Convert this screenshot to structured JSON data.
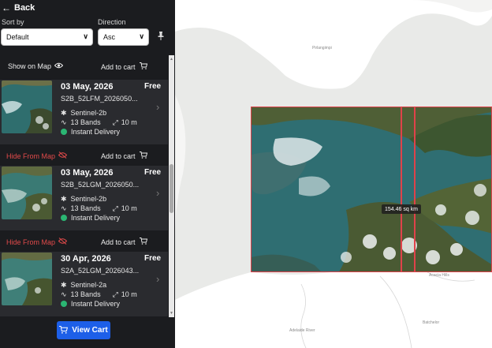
{
  "back_label": "Back",
  "sort": {
    "label": "Sort by",
    "value": "Default"
  },
  "direction": {
    "label": "Direction",
    "value": "Asc"
  },
  "top_actions": {
    "show_label": "Show on Map",
    "cart_label": "Add to cart"
  },
  "cards": [
    {
      "date": "03 May, 2026",
      "price": "Free",
      "product_id": "S2B_52LFM_2026050...",
      "satellite": "Sentinel-2b",
      "bands": "13 Bands",
      "resolution": "10 m",
      "delivery": "Instant Delivery",
      "hide_label": "Hide From Map",
      "cart_label": "Add to cart"
    },
    {
      "date": "03 May, 2026",
      "price": "Free",
      "product_id": "S2B_52LGM_2026050...",
      "satellite": "Sentinel-2b",
      "bands": "13 Bands",
      "resolution": "10 m",
      "delivery": "Instant Delivery",
      "hide_label": "Hide From Map",
      "cart_label": "Add to cart"
    },
    {
      "date": "30 Apr, 2026",
      "price": "Free",
      "product_id": "S2A_52LGM_2026043...",
      "satellite": "Sentinel-2a",
      "bands": "13 Bands",
      "resolution": "10 m",
      "delivery": "Instant Delivery"
    }
  ],
  "view_cart_label": "View Cart",
  "map": {
    "places": [
      "Pirlangimpi",
      "Acacia Hills",
      "Batchelor",
      "Adelaide River"
    ],
    "measurement": "154.46 sq km"
  },
  "colors": {
    "accent": "#1d5fe8",
    "delivery": "#2bb673",
    "hide": "#e24a4a",
    "footprint": "#e0424a"
  }
}
